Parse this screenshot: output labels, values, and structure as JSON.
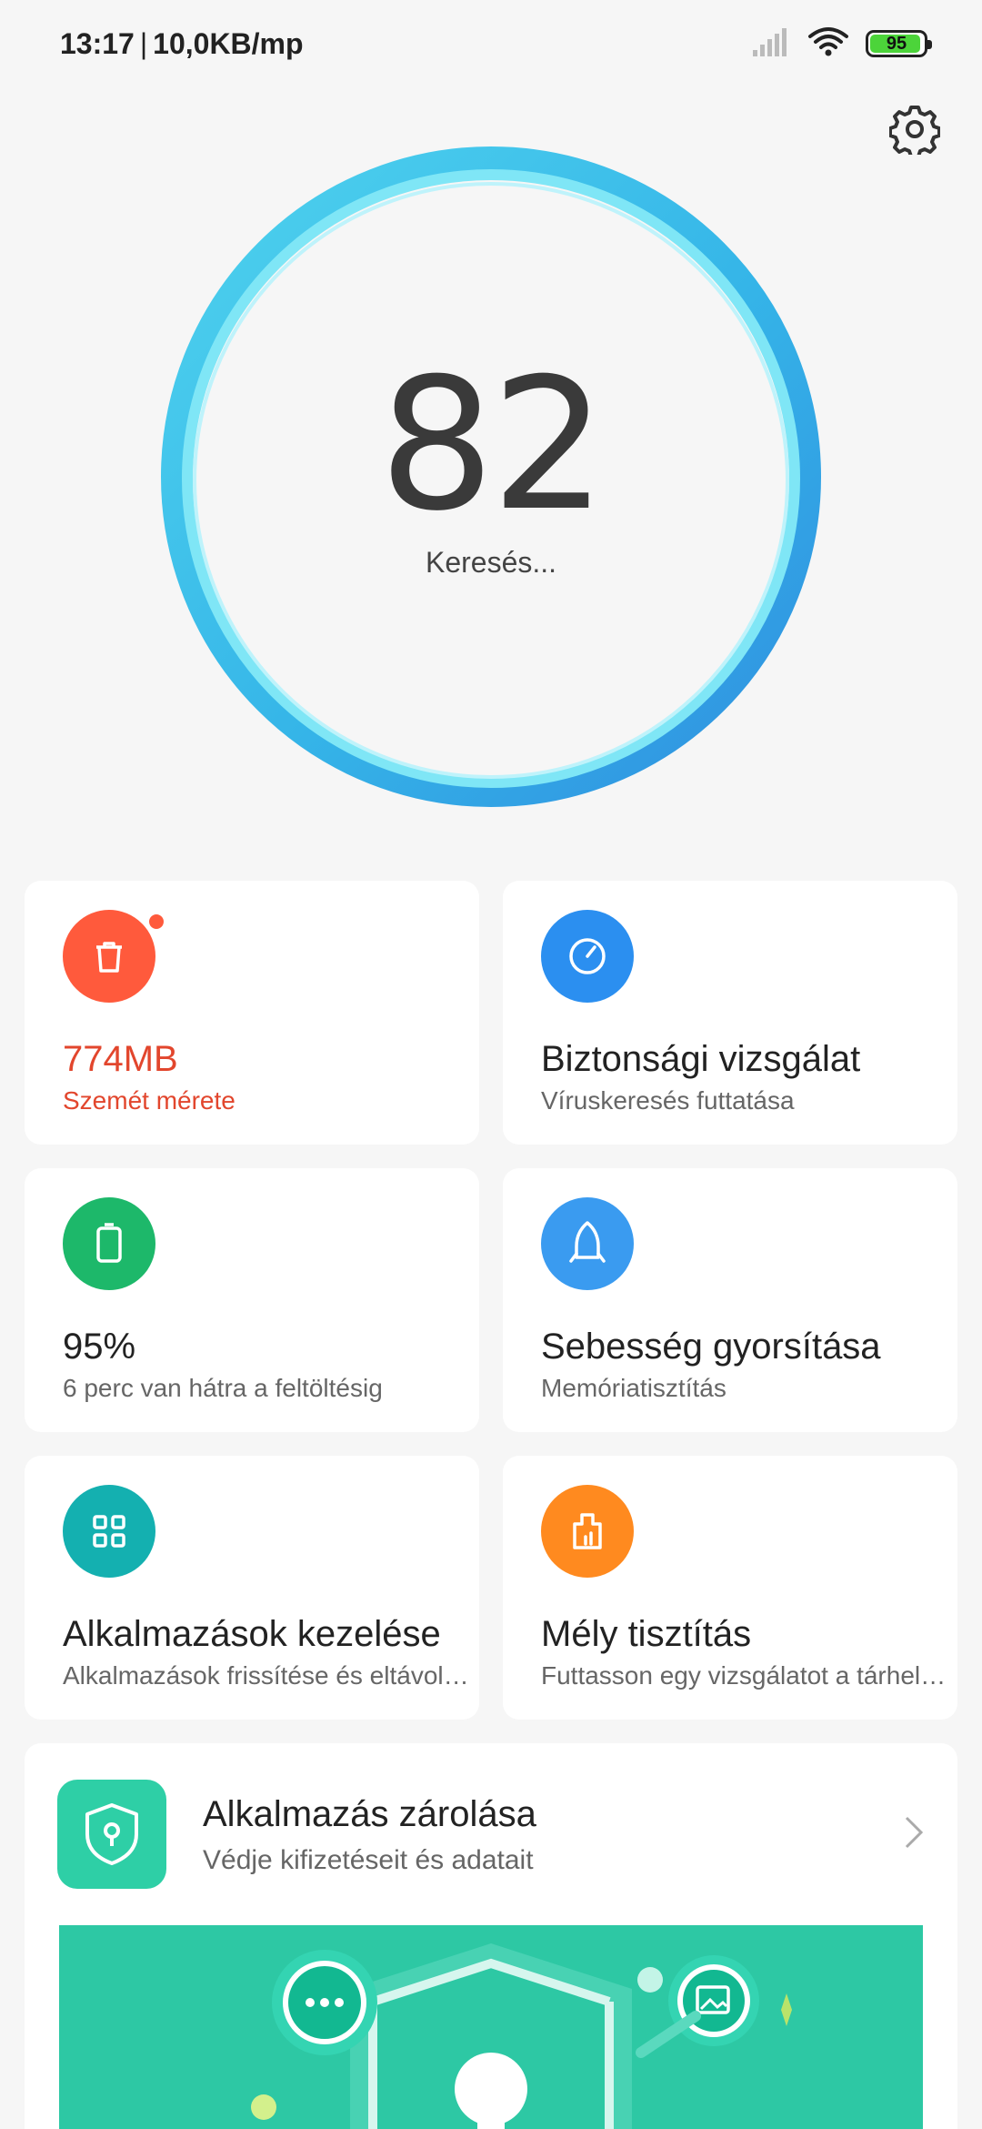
{
  "status": {
    "time": "13:17",
    "separator": "|",
    "speed": "10,0KB/mp",
    "battery_level": "95"
  },
  "scan": {
    "score": "82",
    "label": "Keresés..."
  },
  "cards": [
    {
      "title": "774MB",
      "subtitle": "Szemét mérete",
      "icon": "trash-icon",
      "color": "#ff5a3c"
    },
    {
      "title": "Biztonsági vizsgálat",
      "subtitle": "Víruskeresés futtatása",
      "icon": "gauge-icon",
      "color": "#2b8ff0"
    },
    {
      "title": "95%",
      "subtitle": "6 perc  van hátra a feltöltésig",
      "icon": "battery-icon",
      "color": "#1db86a"
    },
    {
      "title": "Sebesség gyorsítása",
      "subtitle": "Memóriatisztítás",
      "icon": "rocket-icon",
      "color": "#3a9bf0"
    },
    {
      "title": "Alkalmazások kezelése",
      "subtitle": "Alkalmazások frissítése és eltávolítása",
      "icon": "apps-grid-icon",
      "color": "#14b0b0"
    },
    {
      "title": "Mély tisztítás",
      "subtitle": "Futtasson egy vizsgálatot a tárhelyen",
      "icon": "broom-icon",
      "color": "#ff8a1f"
    }
  ],
  "app_lock": {
    "title": "Alkalmazás zárolása",
    "subtitle": "Védje kifizetéseit és adatait"
  },
  "colors": {
    "background": "#f6f6f6",
    "ring_outer": "#2ea3e8",
    "ring_inner": "#7fe6f6",
    "banner": "#2dc8a4"
  }
}
